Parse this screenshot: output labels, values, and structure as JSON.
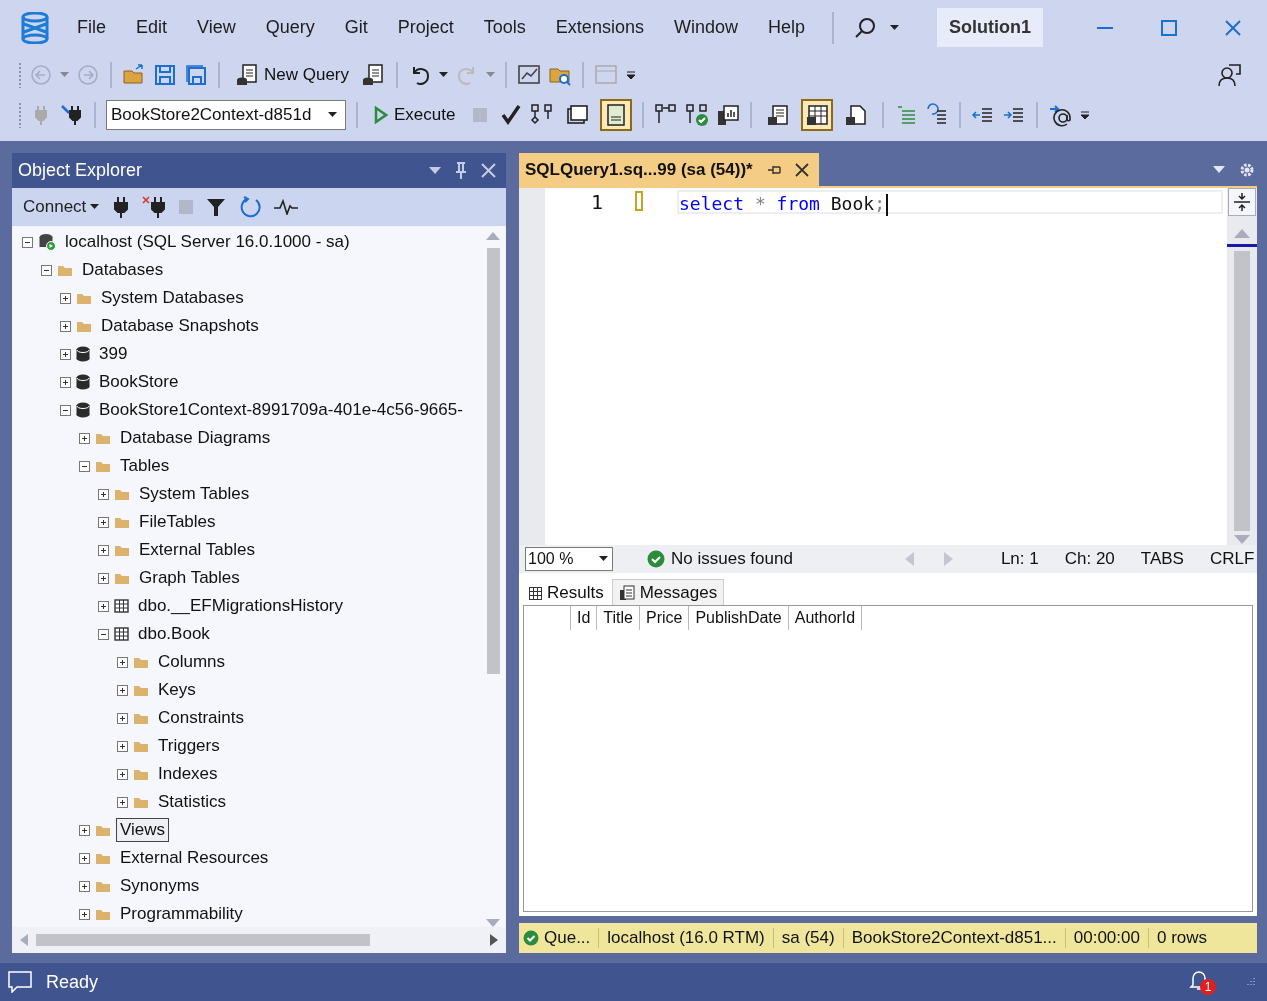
{
  "menu_bar": {
    "items": [
      "File",
      "Edit",
      "View",
      "Query",
      "Git",
      "Project",
      "Tools",
      "Extensions",
      "Window",
      "Help"
    ],
    "solution": "Solution1"
  },
  "standard_toolbar": {
    "new_query": "New Query"
  },
  "query_toolbar": {
    "database": "BookStore2Context-d851d",
    "execute": "Execute",
    "toggles": [
      {
        "on": false
      },
      {
        "on": true
      },
      {
        "on": false
      },
      {
        "on": true
      },
      {
        "on": false
      }
    ]
  },
  "object_explorer": {
    "title": "Object Explorer",
    "connect": "Connect",
    "tree": [
      {
        "label": "localhost (SQL Server 16.0.1000 - sa)",
        "kind": "server",
        "expanded": true,
        "selected": false,
        "children": [
          {
            "label": "Databases",
            "kind": "folder",
            "expanded": true,
            "selected": false,
            "children": [
              {
                "label": "System Databases",
                "kind": "folder",
                "expanded": false,
                "selected": false
              },
              {
                "label": "Database Snapshots",
                "kind": "folder",
                "expanded": false,
                "selected": false
              },
              {
                "label": "399",
                "kind": "database",
                "expanded": false,
                "selected": false
              },
              {
                "label": "BookStore",
                "kind": "database",
                "expanded": false,
                "selected": false
              },
              {
                "label": "BookStore1Context-8991709a-401e-4c56-9665-",
                "kind": "database",
                "expanded": true,
                "selected": false,
                "children": [
                  {
                    "label": "Database Diagrams",
                    "kind": "folder",
                    "expanded": false,
                    "selected": false
                  },
                  {
                    "label": "Tables",
                    "kind": "folder",
                    "expanded": true,
                    "selected": false,
                    "children": [
                      {
                        "label": "System Tables",
                        "kind": "folder",
                        "expanded": false,
                        "selected": false
                      },
                      {
                        "label": "FileTables",
                        "kind": "folder",
                        "expanded": false,
                        "selected": false
                      },
                      {
                        "label": "External Tables",
                        "kind": "folder",
                        "expanded": false,
                        "selected": false
                      },
                      {
                        "label": "Graph Tables",
                        "kind": "folder",
                        "expanded": false,
                        "selected": false
                      },
                      {
                        "label": "dbo.__EFMigrationsHistory",
                        "kind": "table",
                        "expanded": false,
                        "selected": false
                      },
                      {
                        "label": "dbo.Book",
                        "kind": "table",
                        "expanded": true,
                        "selected": false,
                        "children": [
                          {
                            "label": "Columns",
                            "kind": "folder",
                            "expanded": false,
                            "selected": false
                          },
                          {
                            "label": "Keys",
                            "kind": "folder",
                            "expanded": false,
                            "selected": false
                          },
                          {
                            "label": "Constraints",
                            "kind": "folder",
                            "expanded": false,
                            "selected": false
                          },
                          {
                            "label": "Triggers",
                            "kind": "folder",
                            "expanded": false,
                            "selected": false
                          },
                          {
                            "label": "Indexes",
                            "kind": "folder",
                            "expanded": false,
                            "selected": false
                          },
                          {
                            "label": "Statistics",
                            "kind": "folder",
                            "expanded": false,
                            "selected": false
                          }
                        ]
                      }
                    ]
                  },
                  {
                    "label": "Views",
                    "kind": "folder",
                    "expanded": false,
                    "selected": true
                  },
                  {
                    "label": "External Resources",
                    "kind": "folder",
                    "expanded": false,
                    "selected": false
                  },
                  {
                    "label": "Synonyms",
                    "kind": "folder",
                    "expanded": false,
                    "selected": false
                  },
                  {
                    "label": "Programmability",
                    "kind": "folder",
                    "expanded": false,
                    "selected": false
                  }
                ]
              }
            ]
          }
        ]
      }
    ]
  },
  "editor": {
    "tab": "SQLQuery1.sq...99 (sa (54))*",
    "line_number": "1",
    "tokens": [
      {
        "text": "select",
        "kind": "keyword"
      },
      {
        "text": "*",
        "kind": "operator"
      },
      {
        "text": "from",
        "kind": "keyword"
      },
      {
        "text": "Book",
        "kind": "identifier"
      },
      {
        "text": ";",
        "kind": "punctuation"
      }
    ],
    "status": {
      "zoom": "100 %",
      "issues": "No issues found",
      "line": "Ln: 1",
      "column": "Ch: 20",
      "indent": "TABS",
      "line_ending": "CRLF"
    }
  },
  "results": {
    "tabs": [
      {
        "label": "Results",
        "selected": true
      },
      {
        "label": "Messages",
        "selected": false
      }
    ],
    "columns": [
      "Id",
      "Title",
      "Price",
      "PublishDate",
      "AuthorId"
    ]
  },
  "query_status": [
    "Que...",
    "localhost (16.0 RTM)",
    "sa (54)",
    "BookStore2Context-d851...",
    "00:00:00",
    "0 rows"
  ],
  "status_bar": {
    "text": "Ready",
    "notifications": "1"
  }
}
